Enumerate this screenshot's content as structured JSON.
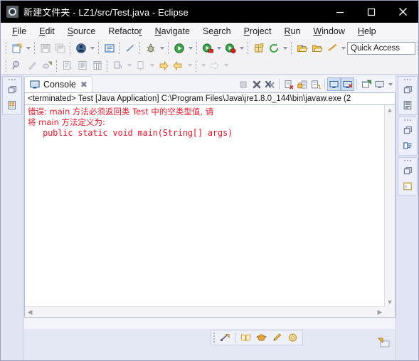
{
  "window": {
    "title": "新建文件夹 - LZ1/src/Test.java - Eclipse",
    "app_icon": "eclipse-icon",
    "minimize_label": "—",
    "maximize_label": "□",
    "close_label": "✕"
  },
  "menu": {
    "items": [
      {
        "mnemonic": "F",
        "rest": "ile"
      },
      {
        "mnemonic": "E",
        "rest": "dit"
      },
      {
        "mnemonic": "S",
        "rest": "ource"
      },
      {
        "mnemonic": "R",
        "rest": "efactor",
        "pre": "Refacto",
        "underline_last": true
      },
      {
        "mnemonic": "N",
        "rest": "avigate"
      },
      {
        "mnemonic": "S",
        "rest": "earch"
      },
      {
        "mnemonic": "P",
        "rest": "roject"
      },
      {
        "mnemonic": "R",
        "rest": "un"
      },
      {
        "mnemonic": "W",
        "rest": "indow"
      },
      {
        "mnemonic": "H",
        "rest": "elp"
      }
    ],
    "labels": [
      "File",
      "Edit",
      "Source",
      "Refactor",
      "Navigate",
      "Search",
      "Project",
      "Run",
      "Window",
      "Help"
    ]
  },
  "toolbar": {
    "row1": [
      "new-wizard-icon",
      "new-wizard-dropdown",
      "save-icon",
      "save-all-icon",
      "new-java-class-icon",
      "new-class-dropdown",
      "open-type-icon",
      "toggle-breadcrumb-icon",
      "debug-icon",
      "debug-dropdown",
      "run-icon",
      "run-dropdown",
      "run-external-tools-icon",
      "external-dropdown",
      "coverage-icon",
      "coverage-dropdown",
      "new-package-icon",
      "refresh-icon",
      "refresh-dropdown",
      "open-folder-icon",
      "open-project-icon",
      "skip-breakpoints-icon",
      "skip-dropdown"
    ],
    "row2": [
      "search-icon",
      "annotation-icon",
      "next-annotation-icon",
      "previous-edit-icon",
      "show-whitespace-icon",
      "column-icon",
      "link-icon",
      "link-dropdown",
      "pin-icon",
      "pin-dropdown",
      "forward-icon",
      "back-icon",
      "back-dropdown",
      "forward2-dropdown",
      "next-arrow-icon",
      "next-dropdown"
    ],
    "quick_access_placeholder": "Quick Access",
    "quick_access_value": "Quick Access",
    "perspective_buttons": [
      "open-perspective-icon",
      "java-ee-perspective-icon",
      "java-perspective-icon"
    ],
    "selected_perspective": "java-perspective-icon"
  },
  "console_view": {
    "tab": {
      "icon": "console-icon",
      "label": "Console",
      "close_icon": "close-tab-icon"
    },
    "tools": [
      {
        "name": "terminate-icon",
        "selected": false
      },
      {
        "name": "remove-launch-icon",
        "selected": false
      },
      {
        "name": "remove-all-terminated-icon",
        "selected": false
      },
      {
        "name": "clear-console-icon",
        "selected": false
      },
      {
        "name": "scroll-lock-icon",
        "selected": false
      },
      {
        "name": "word-wrap-icon",
        "selected": false
      },
      {
        "name": "show-console-on-output-icon",
        "selected": true
      },
      {
        "name": "show-console-on-error-icon",
        "selected": true
      },
      {
        "name": "pin-console-icon",
        "selected": false
      },
      {
        "name": "display-selected-console-icon",
        "selected": false
      },
      {
        "name": "open-console-dropdown",
        "selected": false
      }
    ],
    "terminated_line": "<terminated> Test [Java Application] C:\\Program Files\\Java\\jre1.8.0_144\\bin\\javaw.exe (2",
    "output_lines": [
      {
        "text": "错误: main 方法必须返回类 Test 中的空类型值, 请",
        "style": "cjk"
      },
      {
        "text": "将 main 方法定义为:",
        "style": "cjk"
      },
      {
        "text": "   public static void main(String[] args)",
        "style": "mono"
      }
    ],
    "text_color": "#e8172c",
    "scroll_up_icon": "scroll-up-arrow",
    "scroll_down_icon": "scroll-down-arrow",
    "scroll_left_icon": "scroll-left-arrow",
    "scroll_right_icon": "scroll-right-arrow"
  },
  "left_fastview": {
    "stacks": [
      {
        "grip": "fastview-grip",
        "buttons": [
          "restore-icon",
          "package-explorer-icon"
        ]
      }
    ]
  },
  "right_fastview": {
    "stacks": [
      {
        "grip": "fastview-grip",
        "buttons": [
          "restore-icon",
          "outline-icon"
        ]
      },
      {
        "grip": "fastview-grip",
        "buttons": [
          "restore-icon",
          "task-list-icon"
        ]
      },
      {
        "grip": "fastview-grip",
        "buttons": [
          "restore-icon",
          "properties-view-icon"
        ]
      }
    ]
  },
  "bottom_tray": {
    "items": [
      {
        "name": "restore-minimized-icon",
        "selected": false
      },
      {
        "name": "help-book-icon",
        "selected": false
      },
      {
        "name": "cheat-sheet-icon",
        "selected": false
      },
      {
        "name": "pencil-icon",
        "selected": false
      },
      {
        "name": "gear-wheel-icon",
        "selected": false
      }
    ],
    "corner_icon": "minimized-view-icon"
  },
  "colors": {
    "titlebar_bg": "#000000",
    "titlebar_fg": "#ffffff",
    "menubar_bg": "#f6f6f8",
    "toolbar_bg": "#f2f2f5",
    "workbench_bg": "#e1e5f3",
    "console_bg": "#ffffff",
    "error_text": "#e8172c",
    "selection_blue": "#cfdef2"
  }
}
